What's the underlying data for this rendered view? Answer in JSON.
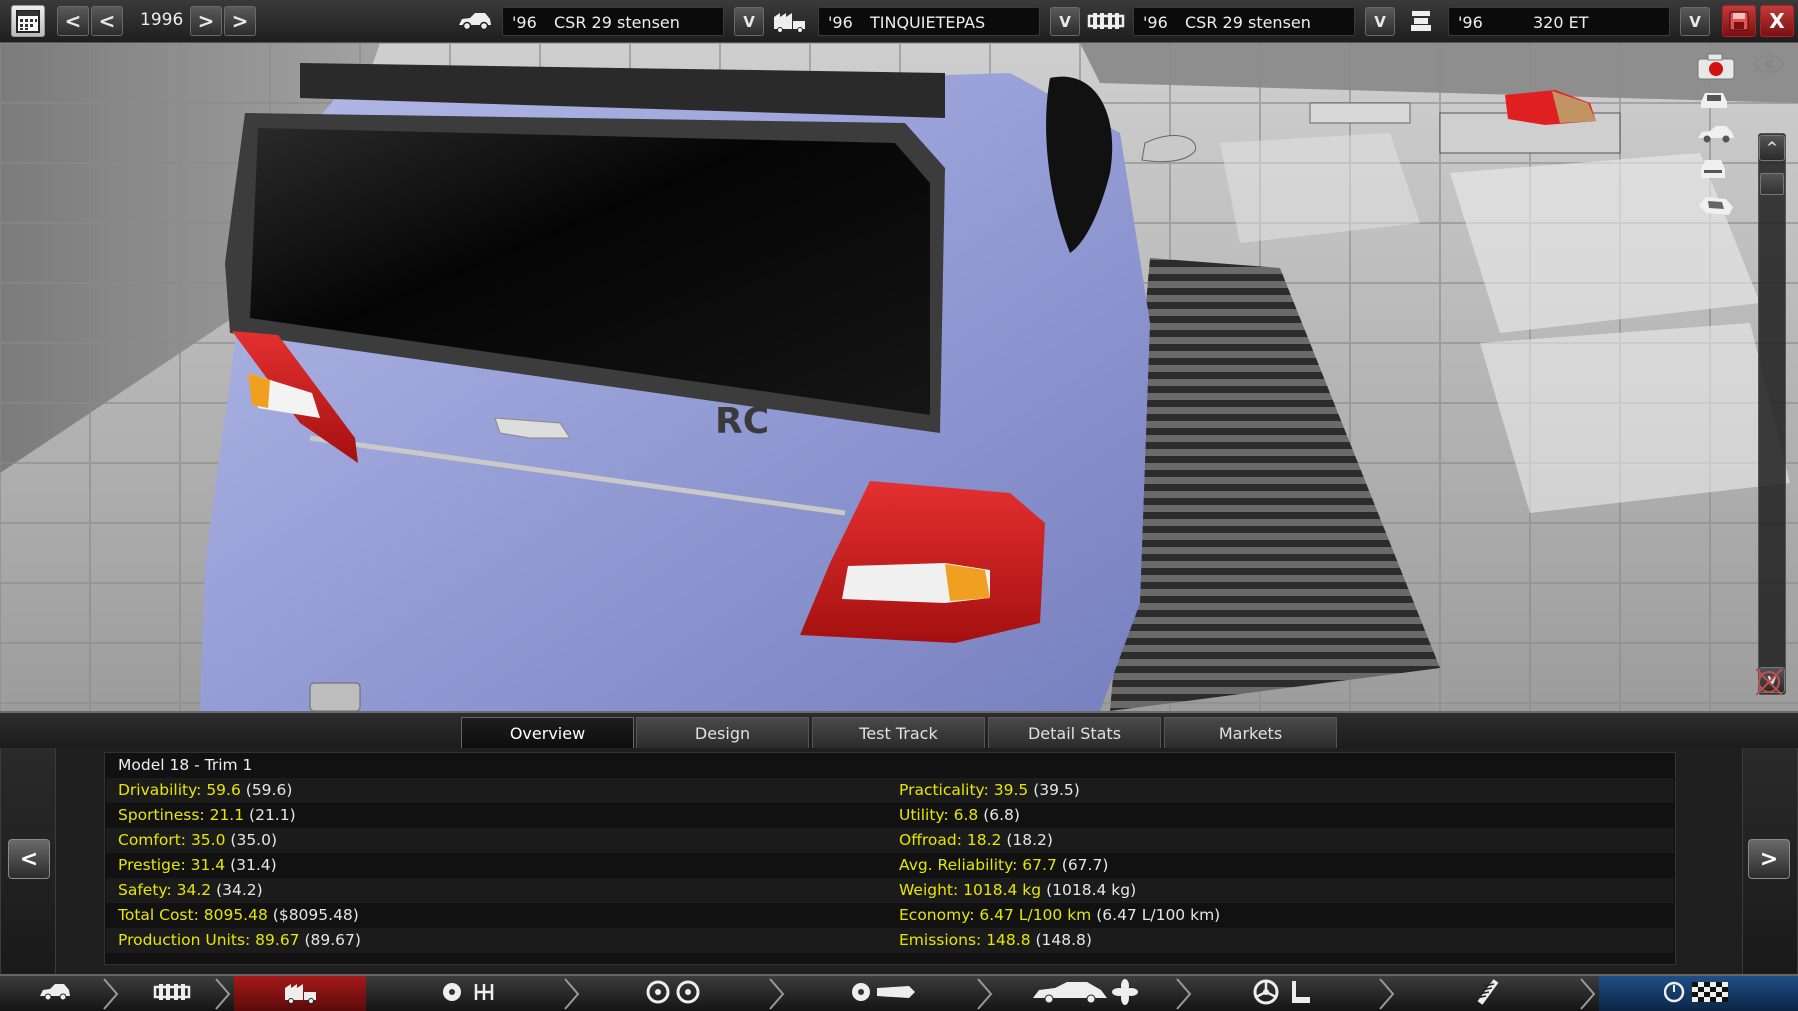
{
  "topbar": {
    "calendar_icon": "calendar-icon",
    "year": "1996",
    "back_fast": "<",
    "back": "<",
    "forward": ">",
    "forward_fast": ">",
    "selectors": [
      {
        "icon": "car-model-icon",
        "year": "'96",
        "name": "CSR 29 stensen",
        "drop": "V"
      },
      {
        "icon": "factory-icon",
        "year": "'96",
        "name": "TINQUIETEPAS",
        "drop": "V"
      },
      {
        "icon": "chassis-icon",
        "year": "'96",
        "name": "CSR 29 stensen",
        "drop": "V"
      },
      {
        "icon": "engine-icon",
        "year": "'96",
        "name": "320 ET",
        "drop": "V"
      }
    ],
    "save_icon": "save-icon",
    "close": "X"
  },
  "viewport": {
    "badge_text": "RC",
    "scroll_up": "^",
    "scroll_down": "v",
    "tools": [
      "camera-record-icon",
      "view-front-icon",
      "view-side-icon",
      "view-rear-icon",
      "view-top-icon",
      "eye-icon",
      "reset-view-icon"
    ]
  },
  "tabs": [
    {
      "label": "Overview",
      "active": true
    },
    {
      "label": "Design",
      "active": false
    },
    {
      "label": "Test Track",
      "active": false
    },
    {
      "label": "Detail Stats",
      "active": false
    },
    {
      "label": "Markets",
      "active": false
    }
  ],
  "panel": {
    "prev": "<",
    "next": ">",
    "model_title": "Model 18 - Trim 1",
    "left_stats": [
      {
        "label": "Drivability: 59.6",
        "paren": "(59.6)"
      },
      {
        "label": "Sportiness: 21.1",
        "paren": "(21.1)"
      },
      {
        "label": "Comfort: 35.0",
        "paren": "(35.0)"
      },
      {
        "label": "Prestige: 31.4",
        "paren": "(31.4)"
      },
      {
        "label": "Safety: 34.2",
        "paren": "(34.2)"
      },
      {
        "label": "Total Cost: 8095.48",
        "paren": "($8095.48)"
      },
      {
        "label": "Production Units: 89.67",
        "paren": "(89.67)"
      }
    ],
    "right_stats": [
      {
        "label": "Practicality: 39.5",
        "paren": "(39.5)"
      },
      {
        "label": "Utility: 6.8",
        "paren": "(6.8)"
      },
      {
        "label": "Offroad: 18.2",
        "paren": "(18.2)"
      },
      {
        "label": "Avg. Reliability: 67.7",
        "paren": "(67.7)"
      },
      {
        "label": "Weight: 1018.4 kg",
        "paren": "(1018.4 kg)"
      },
      {
        "label": "Economy: 6.47 L/100 km",
        "paren": "(6.47 L/100 km)"
      },
      {
        "label": "Emissions: 148.8",
        "paren": "(148.8)"
      }
    ]
  },
  "bottom_nav": [
    "car-model-icon",
    "chassis-icon",
    "body-icon",
    "engine-gearbox-icon",
    "wheels-icon",
    "fixtures-icon",
    "car-design-fan-icon",
    "steering-seat-icon",
    "suspension-icon",
    "finish-flag-icon"
  ],
  "colors": {
    "stat_label": "#e6e600",
    "car_body": "#9aa3d8",
    "taillight_red": "#c81e1e",
    "active_nav_red": "#a51a1a",
    "active_nav_blue": "#1f4f86"
  }
}
